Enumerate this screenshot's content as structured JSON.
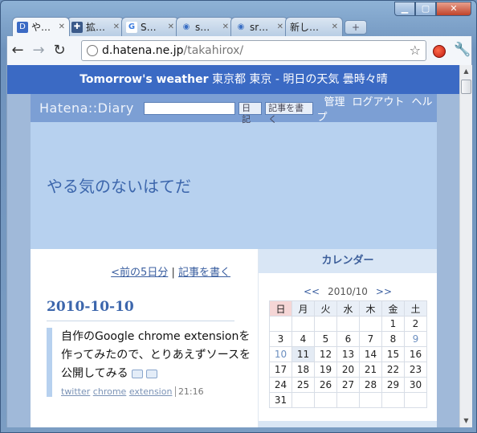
{
  "window": {
    "controls": {
      "minimize": "▁",
      "maximize": "▢",
      "close": "✕"
    }
  },
  "tabs": [
    {
      "label": "や…",
      "icon": "D",
      "icon_name": "hatena-diary-icon",
      "active": true
    },
    {
      "label": "拡…",
      "icon": "✚",
      "icon_name": "extension-puzzle-icon",
      "active": false
    },
    {
      "label": "S…",
      "icon": "G",
      "icon_name": "google-icon",
      "active": false
    },
    {
      "label": "s…",
      "icon": "◉",
      "icon_name": "site-icon",
      "active": false
    },
    {
      "label": "sr…",
      "icon": "◉",
      "icon_name": "site-icon",
      "active": false
    },
    {
      "label": "新し…",
      "icon": "",
      "icon_name": "blank-page-icon",
      "active": false
    }
  ],
  "toolbar": {
    "back": "←",
    "forward": "→",
    "reload": "↻",
    "url_host": "d.hatena.ne.jp",
    "url_path": "/takahirox/",
    "star": "☆",
    "wrench": "🔧"
  },
  "weather": {
    "bold": "Tomorrow's weather",
    "rest": " 東京都 東京 - 明日の天気 曇時々晴"
  },
  "hatena_bar": {
    "logo": "Hatena::Diary",
    "search_button": "日記",
    "write_button": "記事を書く",
    "links": [
      "管理",
      "ログアウト",
      "ヘルプ"
    ]
  },
  "blog": {
    "title": "やる気のないはてだ"
  },
  "pager": {
    "prev": "<前の5日分",
    "sep": " | ",
    "write": "記事を書く"
  },
  "entry": {
    "date": "2010-10-10",
    "title": "自作のGoogle chrome extensionを作ってみたので、とりあえずソースを公開してみる",
    "tags": [
      "twitter",
      "chrome",
      "extension"
    ],
    "time": "21:16"
  },
  "calendar": {
    "heading": "カレンダー",
    "prev": "<<",
    "month": "2010/10",
    "next": ">>",
    "weekdays": [
      "日",
      "月",
      "火",
      "水",
      "木",
      "金",
      "土"
    ],
    "weeks": [
      [
        "",
        "",
        "",
        "",
        "",
        "1",
        "2"
      ],
      [
        "3",
        "4",
        "5",
        "6",
        "7",
        "8",
        "9"
      ],
      [
        "10",
        "11",
        "12",
        "13",
        "14",
        "15",
        "16"
      ],
      [
        "17",
        "18",
        "19",
        "20",
        "21",
        "22",
        "23"
      ],
      [
        "24",
        "25",
        "26",
        "27",
        "28",
        "29",
        "30"
      ],
      [
        "31",
        "",
        "",
        "",
        "",
        "",
        ""
      ]
    ],
    "today": "11",
    "linked_days": [
      "9",
      "10"
    ]
  }
}
